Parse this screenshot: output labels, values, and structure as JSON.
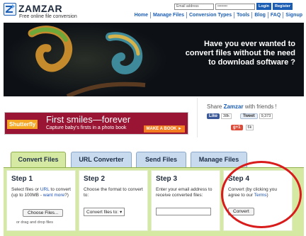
{
  "header": {
    "logo_text": "ZAMZAR",
    "tagline": "Free online file conversion",
    "email_placeholder": "Email address",
    "password_mask": "••••••••",
    "login_label": "Login",
    "register_label": "Register",
    "nav": [
      "Home",
      "Manage Files",
      "Conversion Types",
      "Tools",
      "Blog",
      "FAQ",
      "Signup"
    ]
  },
  "hero": {
    "lines": [
      "Have you ever wanted to",
      "convert files without the need",
      "to download software ?"
    ]
  },
  "promo": {
    "brand": "Shutterfly",
    "headline": "First smiles—forever",
    "subline": "Capture baby's firsts in a photo book",
    "cta": "MAKE A BOOK ►"
  },
  "share": {
    "prefix": "Share ",
    "brand": "Zamzar",
    "suffix": " with friends !",
    "like_label": "Like",
    "like_count": "38k",
    "tweet_label": "Tweet",
    "tweet_count": "9,373",
    "gplus_label": "g+1",
    "gplus_count": "6k"
  },
  "tabs": [
    "Convert Files",
    "URL Converter",
    "Send Files",
    "Manage Files"
  ],
  "steps": [
    {
      "title": "Step 1",
      "text_a": "Select files or ",
      "link_a": "URL",
      "text_b": " to convert (up to 100MB - ",
      "link_b": "want more",
      "text_c": "?)",
      "button": "Choose Files...",
      "note": "or drag and drop files"
    },
    {
      "title": "Step 2",
      "text": "Choose the format to convert to:",
      "select": "Convert files to:"
    },
    {
      "title": "Step 3",
      "text": "Enter your email address to receive converted files:"
    },
    {
      "title": "Step 4",
      "text_a": "Convert (by clicking you agree to our ",
      "link": "Terms",
      "text_b": ")",
      "button": "Convert"
    }
  ],
  "colors": {
    "brand_blue": "#1b5db3",
    "panel_green": "#d6e9a3",
    "highlight_red": "#d81c1c"
  }
}
